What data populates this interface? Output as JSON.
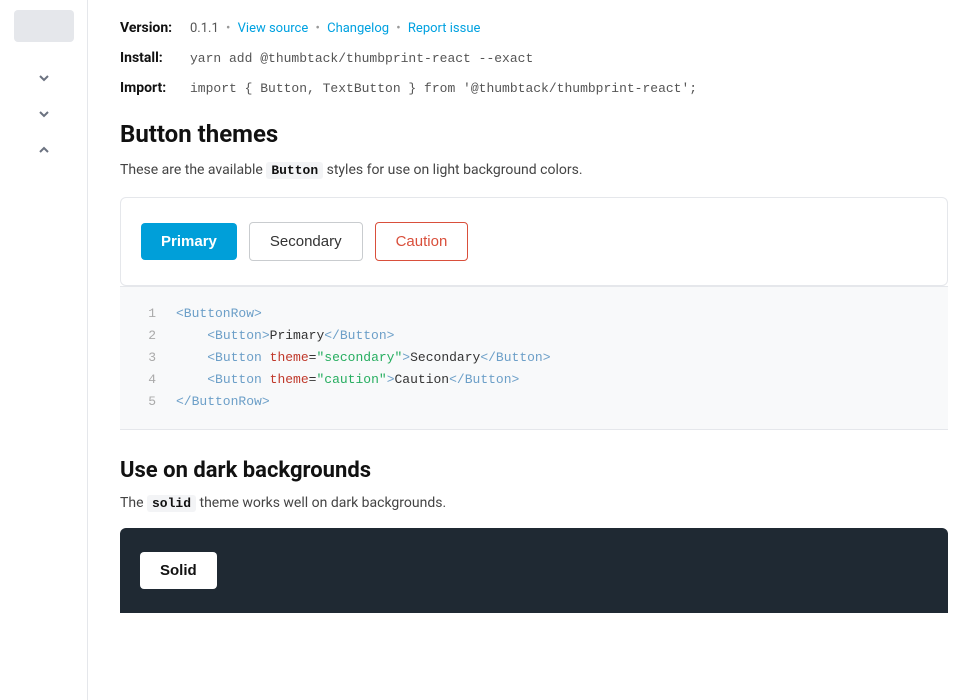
{
  "sidebar": {
    "chevrons": [
      {
        "direction": "down",
        "name": "chevron-down-1"
      },
      {
        "direction": "down",
        "name": "chevron-down-2"
      },
      {
        "direction": "up",
        "name": "chevron-up-1"
      }
    ]
  },
  "meta": {
    "version_label": "Version:",
    "version_number": "0.1.1",
    "dot1": "•",
    "view_source": "View source",
    "dot2": "•",
    "changelog": "Changelog",
    "dot3": "•",
    "report_issue": "Report issue",
    "install_label": "Install:",
    "install_value": "yarn add @thumbtack/thumbprint-react --exact",
    "import_label": "Import:",
    "import_value": "import { Button, TextButton } from '@thumbtack/thumbprint-react';"
  },
  "button_themes": {
    "section_title": "Button themes",
    "description_prefix": "These are the available",
    "description_code": "Button",
    "description_suffix": "styles for use on light background colors.",
    "buttons": [
      {
        "label": "Primary",
        "variant": "primary"
      },
      {
        "label": "Secondary",
        "variant": "secondary"
      },
      {
        "label": "Caution",
        "variant": "caution"
      }
    ]
  },
  "code_example": {
    "lines": [
      {
        "num": "1",
        "html": "<ButtonRow>"
      },
      {
        "num": "2",
        "html": "    <Button>Primary</Button>"
      },
      {
        "num": "3",
        "html": "    <Button theme=\"secondary\">Secondary</Button>"
      },
      {
        "num": "4",
        "html": "    <Button theme=\"caution\">Caution</Button>"
      },
      {
        "num": "5",
        "html": "</ButtonRow>"
      }
    ]
  },
  "dark_section": {
    "title": "Use on dark backgrounds",
    "description_prefix": "The",
    "description_code": "solid",
    "description_suffix": "theme works well on dark backgrounds.",
    "solid_button_label": "Solid"
  },
  "colors": {
    "primary_btn_bg": "#009fd9",
    "caution_color": "#d94f3b",
    "dark_bg": "#1f2933",
    "link_color": "#00a1e0"
  }
}
